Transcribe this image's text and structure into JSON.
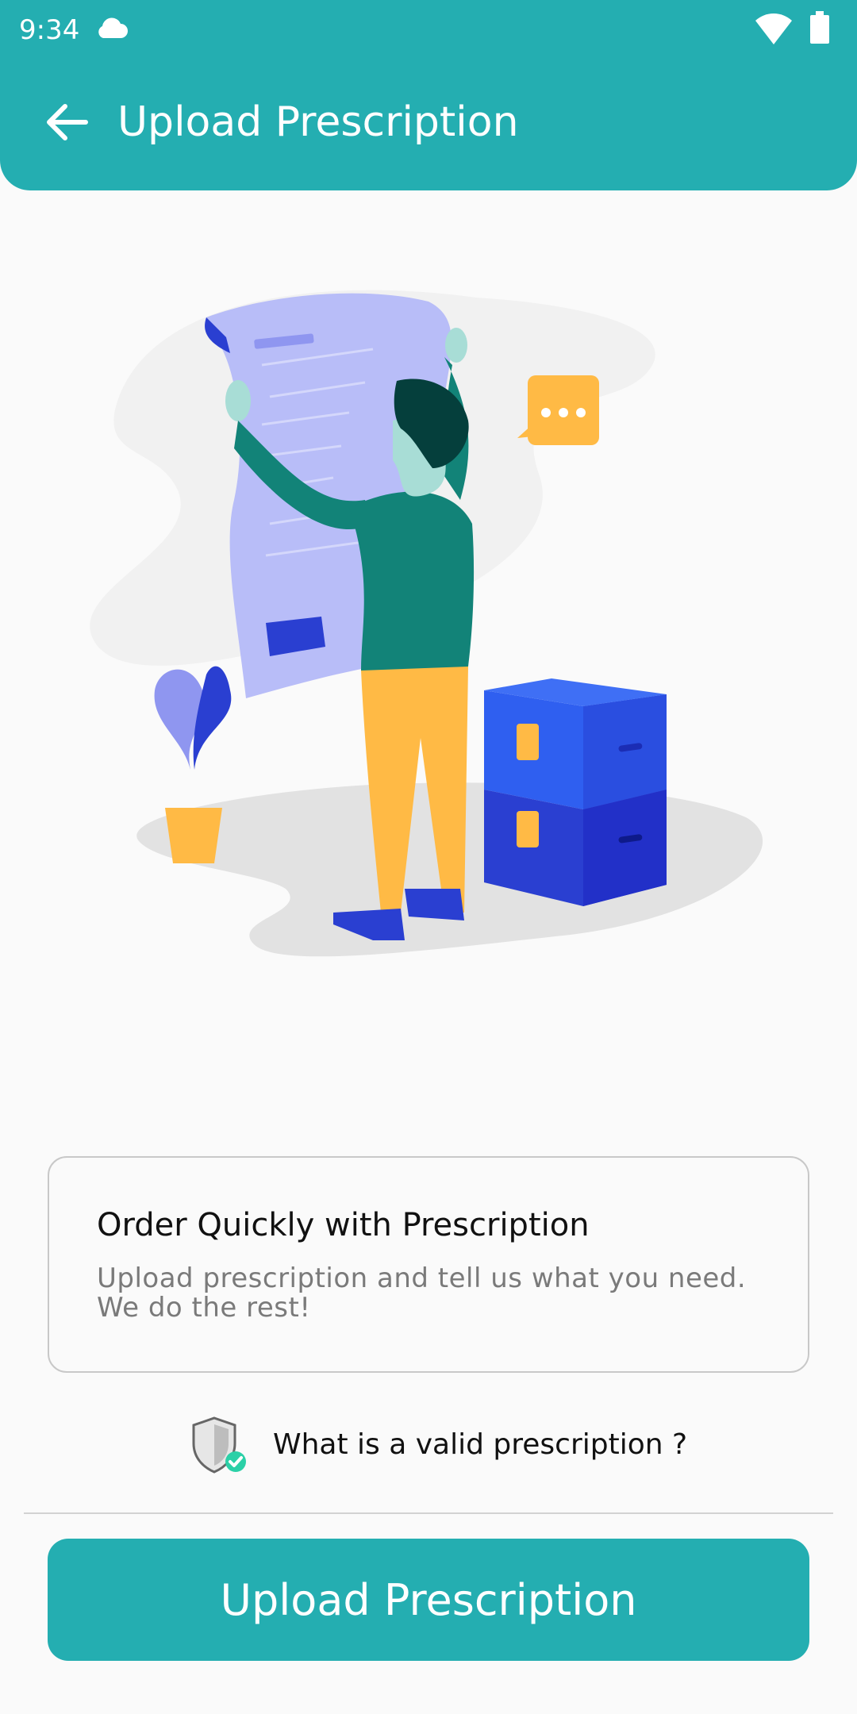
{
  "status_bar": {
    "time": "9:34",
    "icons": [
      "cloud-icon",
      "wifi-icon",
      "battery-icon"
    ]
  },
  "app_bar": {
    "back_icon": "arrow-left-icon",
    "title": "Upload Prescription"
  },
  "info_card": {
    "title": "Order Quickly with Prescription",
    "description": "Upload prescription and tell us what you need. We do the rest!"
  },
  "valid_prescription": {
    "icon": "shield-check-icon",
    "label": "What is a valid prescription ?"
  },
  "primary_button": {
    "label": "Upload Prescription"
  },
  "colors": {
    "primary": "#24aeb1",
    "background": "#fafafa"
  }
}
